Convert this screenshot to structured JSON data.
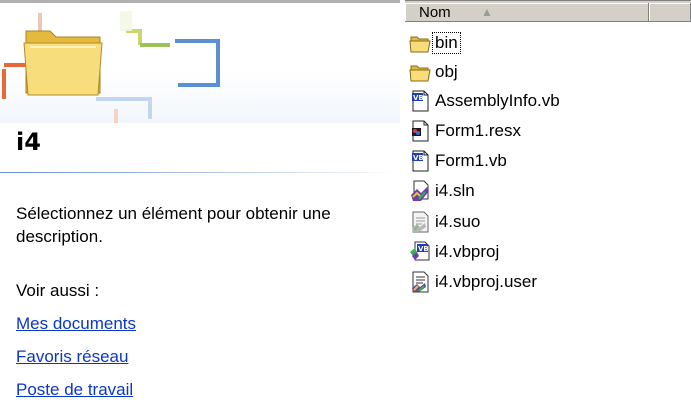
{
  "left_pane": {
    "folder_title": "i4",
    "description": "Sélectionnez un élément pour obtenir une description.",
    "see_also_label": "Voir aussi :",
    "links": [
      "Mes documents",
      "Favoris réseau",
      "Poste de travail"
    ]
  },
  "file_list": {
    "header": {
      "name_column": "Nom",
      "sort_indicator": "ascending"
    },
    "items": [
      {
        "name": "bin",
        "icon": "folder-icon",
        "focused": true
      },
      {
        "name": "obj",
        "icon": "folder-icon"
      },
      {
        "name": "AssemblyInfo.vb",
        "icon": "vb-file-icon"
      },
      {
        "name": "Form1.resx",
        "icon": "resx-file-icon"
      },
      {
        "name": "Form1.vb",
        "icon": "vb-file-icon"
      },
      {
        "name": "i4.sln",
        "icon": "solution-file-icon"
      },
      {
        "name": "i4.suo",
        "icon": "suo-file-icon"
      },
      {
        "name": "i4.vbproj",
        "icon": "vbproj-file-icon"
      },
      {
        "name": "i4.vbproj.user",
        "icon": "vbproj-user-file-icon"
      }
    ]
  },
  "colors": {
    "link": "#0b37c7",
    "header_bg": "#d4d0c8",
    "folder_yellow": "#f5d66b"
  }
}
